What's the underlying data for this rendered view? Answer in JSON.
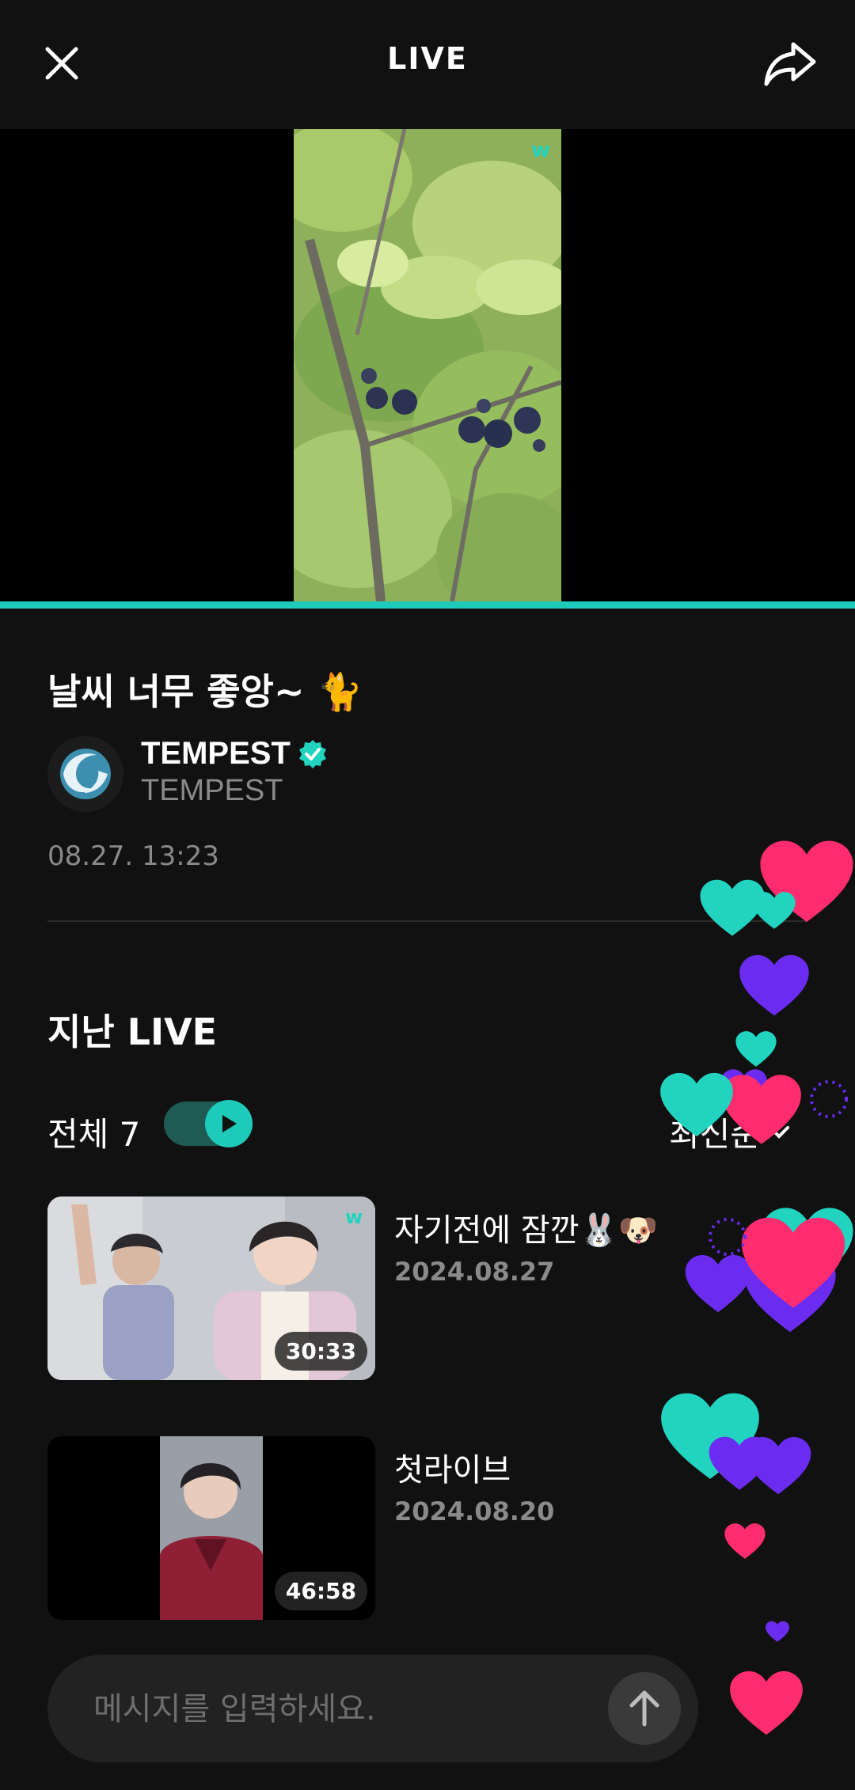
{
  "header": {
    "title": "LIVE",
    "close_icon": "close-icon",
    "share_icon": "share-icon"
  },
  "player": {
    "progress_fraction": 1.0,
    "accent_color": "#1ecab9"
  },
  "live": {
    "title": "날씨 너무 좋앙~ 🐈",
    "channel_name": "TEMPEST",
    "channel_sub": "TEMPEST",
    "date": "08.27. 13:23"
  },
  "past": {
    "section_title": "지난 LIVE",
    "count_label": "전체 7",
    "sort_label": "최신순",
    "items": [
      {
        "title": "자기전에 잠깐🐰🐶",
        "date": "2024.08.27",
        "duration": "30:33"
      },
      {
        "title": "첫라이브",
        "date": "2024.08.20",
        "duration": "46:58"
      }
    ]
  },
  "chat": {
    "placeholder": "메시지를 입력하세요."
  },
  "colors": {
    "pink": "#ff2d6f",
    "teal": "#22d3c0",
    "purple": "#6b2cf0"
  }
}
